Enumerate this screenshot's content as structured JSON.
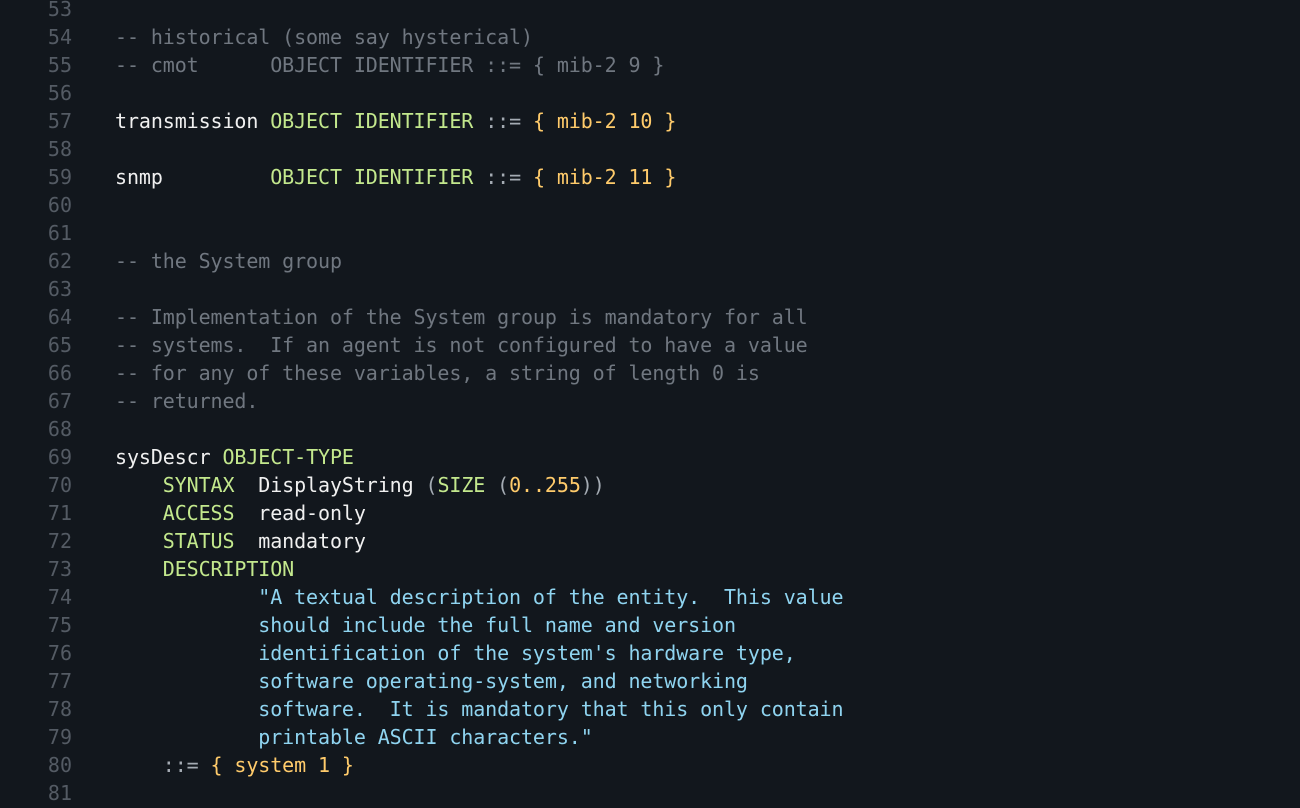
{
  "editor": {
    "background": "#12171d",
    "colors": {
      "line_number": "#545b64",
      "comment": "#707780",
      "identifier": "#f0f0f0",
      "keyword": "#c3e88d",
      "operator": "#a4abb3",
      "brace": "#ffcb6b",
      "number": "#ffcb6b",
      "string": "#8fd4f0"
    },
    "lines": [
      {
        "n": "53",
        "tokens": []
      },
      {
        "n": "54",
        "tokens": [
          {
            "t": "comment",
            "v": "-- historical (some say hysterical)"
          }
        ]
      },
      {
        "n": "55",
        "tokens": [
          {
            "t": "comment",
            "v": "-- cmot      OBJECT IDENTIFIER ::= { mib-2 9 }"
          }
        ]
      },
      {
        "n": "56",
        "tokens": []
      },
      {
        "n": "57",
        "tokens": [
          {
            "t": "identifier",
            "v": "transmission "
          },
          {
            "t": "keyword",
            "v": "OBJECT IDENTIFIER "
          },
          {
            "t": "operator",
            "v": "::= "
          },
          {
            "t": "brace",
            "v": "{ "
          },
          {
            "t": "number",
            "v": "mib-2 10"
          },
          {
            "t": "brace",
            "v": " }"
          }
        ]
      },
      {
        "n": "58",
        "tokens": []
      },
      {
        "n": "59",
        "tokens": [
          {
            "t": "identifier",
            "v": "snmp         "
          },
          {
            "t": "keyword",
            "v": "OBJECT IDENTIFIER "
          },
          {
            "t": "operator",
            "v": "::= "
          },
          {
            "t": "brace",
            "v": "{ "
          },
          {
            "t": "number",
            "v": "mib-2 11"
          },
          {
            "t": "brace",
            "v": " }"
          }
        ]
      },
      {
        "n": "60",
        "tokens": []
      },
      {
        "n": "61",
        "tokens": []
      },
      {
        "n": "62",
        "tokens": [
          {
            "t": "comment",
            "v": "-- the System group"
          }
        ]
      },
      {
        "n": "63",
        "tokens": []
      },
      {
        "n": "64",
        "tokens": [
          {
            "t": "comment",
            "v": "-- Implementation of the System group is mandatory for all"
          }
        ]
      },
      {
        "n": "65",
        "tokens": [
          {
            "t": "comment",
            "v": "-- systems.  If an agent is not configured to have a value"
          }
        ]
      },
      {
        "n": "66",
        "tokens": [
          {
            "t": "comment",
            "v": "-- for any of these variables, a string of length 0 is"
          }
        ]
      },
      {
        "n": "67",
        "tokens": [
          {
            "t": "comment",
            "v": "-- returned."
          }
        ]
      },
      {
        "n": "68",
        "tokens": []
      },
      {
        "n": "69",
        "tokens": [
          {
            "t": "identifier",
            "v": "sysDescr "
          },
          {
            "t": "keyword",
            "v": "OBJECT-TYPE"
          }
        ]
      },
      {
        "n": "70",
        "tokens": [
          {
            "t": "keyword",
            "v": "    SYNTAX  "
          },
          {
            "t": "identifier",
            "v": "DisplayString "
          },
          {
            "t": "operator",
            "v": "("
          },
          {
            "t": "keyword",
            "v": "SIZE "
          },
          {
            "t": "operator",
            "v": "("
          },
          {
            "t": "number",
            "v": "0..255"
          },
          {
            "t": "operator",
            "v": "))"
          }
        ]
      },
      {
        "n": "71",
        "tokens": [
          {
            "t": "keyword",
            "v": "    ACCESS  "
          },
          {
            "t": "identifier",
            "v": "read-only"
          }
        ]
      },
      {
        "n": "72",
        "tokens": [
          {
            "t": "keyword",
            "v": "    STATUS  "
          },
          {
            "t": "identifier",
            "v": "mandatory"
          }
        ]
      },
      {
        "n": "73",
        "tokens": [
          {
            "t": "keyword",
            "v": "    DESCRIPTION"
          }
        ]
      },
      {
        "n": "74",
        "tokens": [
          {
            "t": "string",
            "v": "            \"A textual description of the entity.  This value"
          }
        ]
      },
      {
        "n": "75",
        "tokens": [
          {
            "t": "string",
            "v": "            should include the full name and version"
          }
        ]
      },
      {
        "n": "76",
        "tokens": [
          {
            "t": "string",
            "v": "            identification of the system's hardware type,"
          }
        ]
      },
      {
        "n": "77",
        "tokens": [
          {
            "t": "string",
            "v": "            software operating-system, and networking"
          }
        ]
      },
      {
        "n": "78",
        "tokens": [
          {
            "t": "string",
            "v": "            software.  It is mandatory that this only contain"
          }
        ]
      },
      {
        "n": "79",
        "tokens": [
          {
            "t": "string",
            "v": "            printable ASCII characters.\""
          }
        ]
      },
      {
        "n": "80",
        "tokens": [
          {
            "t": "operator",
            "v": "    ::= "
          },
          {
            "t": "brace",
            "v": "{ "
          },
          {
            "t": "number",
            "v": "system 1"
          },
          {
            "t": "brace",
            "v": " }"
          }
        ]
      },
      {
        "n": "81",
        "tokens": []
      }
    ]
  }
}
